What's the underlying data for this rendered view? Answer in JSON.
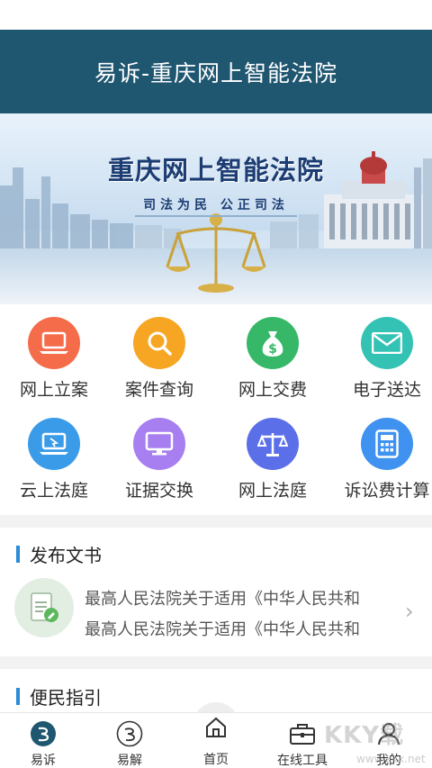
{
  "app": {
    "title": "易诉-重庆网上智能法院"
  },
  "banner": {
    "title": "重庆网上智能法院",
    "slogan": "司法为民  公正司法"
  },
  "services": [
    {
      "label": "网上立案",
      "icon": "laptop-icon",
      "color": "#f56c4b"
    },
    {
      "label": "案件查询",
      "icon": "search-icon",
      "color": "#f6a623"
    },
    {
      "label": "网上交费",
      "icon": "money-bag-icon",
      "color": "#36b868"
    },
    {
      "label": "电子送达",
      "icon": "envelope-icon",
      "color": "#33c2b4"
    },
    {
      "label": "云上法庭",
      "icon": "cloud-laptop-icon",
      "color": "#3a9be8"
    },
    {
      "label": "证据交换",
      "icon": "monitor-icon",
      "color": "#a77ff0"
    },
    {
      "label": "网上法庭",
      "icon": "scales-icon",
      "color": "#5b70e8"
    },
    {
      "label": "诉讼费计算",
      "icon": "calculator-icon",
      "color": "#3f92f0"
    }
  ],
  "documents": {
    "heading": "发布文书",
    "items": [
      "最高人民法院关于适用《中华人民共和",
      "最高人民法院关于适用《中华人民共和"
    ]
  },
  "guide": {
    "heading": "便民指引"
  },
  "tabs": [
    {
      "label": "易诉",
      "icon": "yisu-logo-icon"
    },
    {
      "label": "易解",
      "icon": "yijie-logo-icon"
    },
    {
      "label": "首页",
      "icon": "home-icon"
    },
    {
      "label": "在线工具",
      "icon": "toolbox-icon"
    },
    {
      "label": "我的",
      "icon": "user-icon"
    }
  ],
  "watermark": {
    "brand": "KKY载",
    "url": "www.kkx.net"
  }
}
